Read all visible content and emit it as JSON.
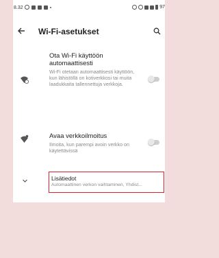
{
  "status_bar": {
    "time": "8.32",
    "right_text": "97"
  },
  "app_bar": {
    "title": "Wi-Fi-asetukset",
    "back_icon": "arrow-left-icon",
    "search_icon": "search-icon"
  },
  "settings": {
    "auto_wifi": {
      "title": "Ota Wi-Fi käyttöön automaattisesti",
      "description": "Wi-Fi otetaan automaattisesti käyttöön, kun lähistöllä on kotiverkkosi tai muita laadukkaita tallennettuja verkkoja.",
      "enabled": false
    },
    "open_network_notify": {
      "title": "Avaa verkkoilmoitus",
      "description": "Ilmoita, kun parempi avoin verkko on käytettävissä",
      "enabled": false
    },
    "advanced": {
      "title": "Lisätiedot",
      "summary": "Automaattinen verkon vaihtaminen, Yhdist..."
    }
  },
  "colors": {
    "highlight": "#e0202a",
    "background": "#f3dcdc"
  }
}
